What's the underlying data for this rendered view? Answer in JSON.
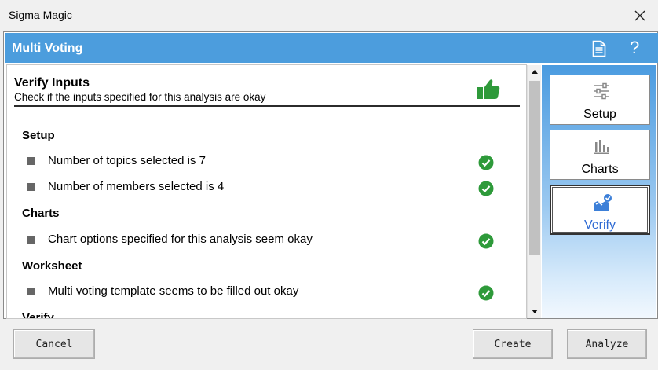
{
  "window": {
    "title": "Sigma Magic"
  },
  "header": {
    "title": "Multi Voting",
    "help_label": "?"
  },
  "verify": {
    "title": "Verify Inputs",
    "subtitle": "Check if the inputs specified for this analysis are okay"
  },
  "sections": [
    {
      "title": "Setup",
      "items": [
        "Number of topics selected is 7",
        "Number of members selected is 4"
      ]
    },
    {
      "title": "Charts",
      "items": [
        "Chart options specified for this analysis seem okay"
      ]
    },
    {
      "title": "Worksheet",
      "items": [
        "Multi voting template seems to be filled out okay"
      ]
    },
    {
      "title": "Verify",
      "items": []
    }
  ],
  "sidebar": {
    "items": [
      {
        "label": "Setup",
        "icon": "sliders-icon"
      },
      {
        "label": "Charts",
        "icon": "bar-chart-icon"
      },
      {
        "label": "Verify",
        "icon": "verify-icon",
        "active": true
      }
    ]
  },
  "footer": {
    "cancel": "Cancel",
    "create": "Create",
    "analyze": "Analyze"
  },
  "colors": {
    "header": "#4c9ddd",
    "check": "#2e9a3a",
    "active_label": "#2f6bd4"
  }
}
